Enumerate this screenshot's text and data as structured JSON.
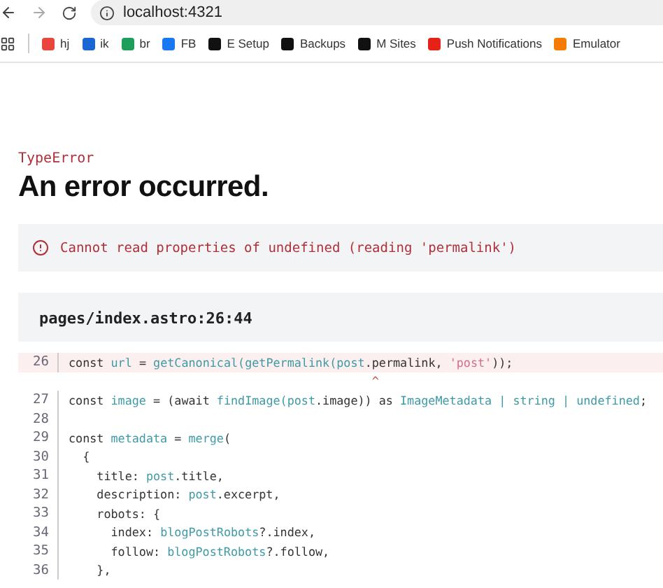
{
  "browser": {
    "url": "localhost:4321"
  },
  "bookmarks": [
    {
      "label": "hj",
      "color": "#e8453c"
    },
    {
      "label": "ik",
      "color": "#1a66d2"
    },
    {
      "label": "br",
      "color": "#1e9e5a"
    },
    {
      "label": "FB",
      "color": "#1877f2"
    },
    {
      "label": "E Setup",
      "color": "#111111"
    },
    {
      "label": "Backups",
      "color": "#111111"
    },
    {
      "label": "M Sites",
      "color": "#111111"
    },
    {
      "label": "Push Notifications",
      "color": "#e62117"
    },
    {
      "label": "Emulator",
      "color": "#f57c00"
    }
  ],
  "error": {
    "type": "TypeError",
    "title": "An error occurred.",
    "message": "Cannot read properties of undefined (reading 'permalink')"
  },
  "code": {
    "file": "pages/index.astro:26:44",
    "lines": [
      {
        "number": "26",
        "highlighted": true,
        "marker": "                                           ^",
        "tokens": [
          {
            "text": "const ",
            "kind": "plain"
          },
          {
            "text": "url",
            "kind": "ident"
          },
          {
            "text": " = ",
            "kind": "plain"
          },
          {
            "text": "getCanonical(getPermalink(post",
            "kind": "ident"
          },
          {
            "text": ".permalink, ",
            "kind": "plain"
          },
          {
            "text": "'post'",
            "kind": "string"
          },
          {
            "text": "));",
            "kind": "plain"
          }
        ]
      },
      {
        "number": "27",
        "highlighted": false,
        "tokens": [
          {
            "text": "const ",
            "kind": "plain"
          },
          {
            "text": "image",
            "kind": "ident"
          },
          {
            "text": " = (await ",
            "kind": "plain"
          },
          {
            "text": "findImage(post",
            "kind": "ident"
          },
          {
            "text": ".image)) as ",
            "kind": "plain"
          },
          {
            "text": "ImageMetadata | string | undefined",
            "kind": "ident"
          },
          {
            "text": ";",
            "kind": "plain"
          }
        ]
      },
      {
        "number": "28",
        "highlighted": false
      },
      {
        "number": "29",
        "highlighted": false,
        "tokens": [
          {
            "text": "const ",
            "kind": "plain"
          },
          {
            "text": "metadata",
            "kind": "ident"
          },
          {
            "text": " = ",
            "kind": "plain"
          },
          {
            "text": "merge",
            "kind": "ident"
          },
          {
            "text": "(",
            "kind": "plain"
          }
        ]
      },
      {
        "number": "30",
        "highlighted": false,
        "tokens": [
          {
            "text": "  {",
            "kind": "plain"
          }
        ]
      },
      {
        "number": "31",
        "highlighted": false,
        "tokens": [
          {
            "text": "    title: ",
            "kind": "plain"
          },
          {
            "text": "post",
            "kind": "ident"
          },
          {
            "text": ".title,",
            "kind": "plain"
          }
        ]
      },
      {
        "number": "32",
        "highlighted": false,
        "tokens": [
          {
            "text": "    description: ",
            "kind": "plain"
          },
          {
            "text": "post",
            "kind": "ident"
          },
          {
            "text": ".excerpt,",
            "kind": "plain"
          }
        ]
      },
      {
        "number": "33",
        "highlighted": false,
        "tokens": [
          {
            "text": "    robots: {",
            "kind": "plain"
          }
        ]
      },
      {
        "number": "34",
        "highlighted": false,
        "tokens": [
          {
            "text": "      index: ",
            "kind": "plain"
          },
          {
            "text": "blogPostRobots",
            "kind": "ident"
          },
          {
            "text": "?.index,",
            "kind": "plain"
          }
        ]
      },
      {
        "number": "35",
        "highlighted": false,
        "tokens": [
          {
            "text": "      follow: ",
            "kind": "plain"
          },
          {
            "text": "blogPostRobots",
            "kind": "ident"
          },
          {
            "text": "?.follow,",
            "kind": "plain"
          }
        ]
      },
      {
        "number": "36",
        "highlighted": false,
        "tokens": [
          {
            "text": "    },",
            "kind": "plain"
          }
        ]
      }
    ]
  }
}
